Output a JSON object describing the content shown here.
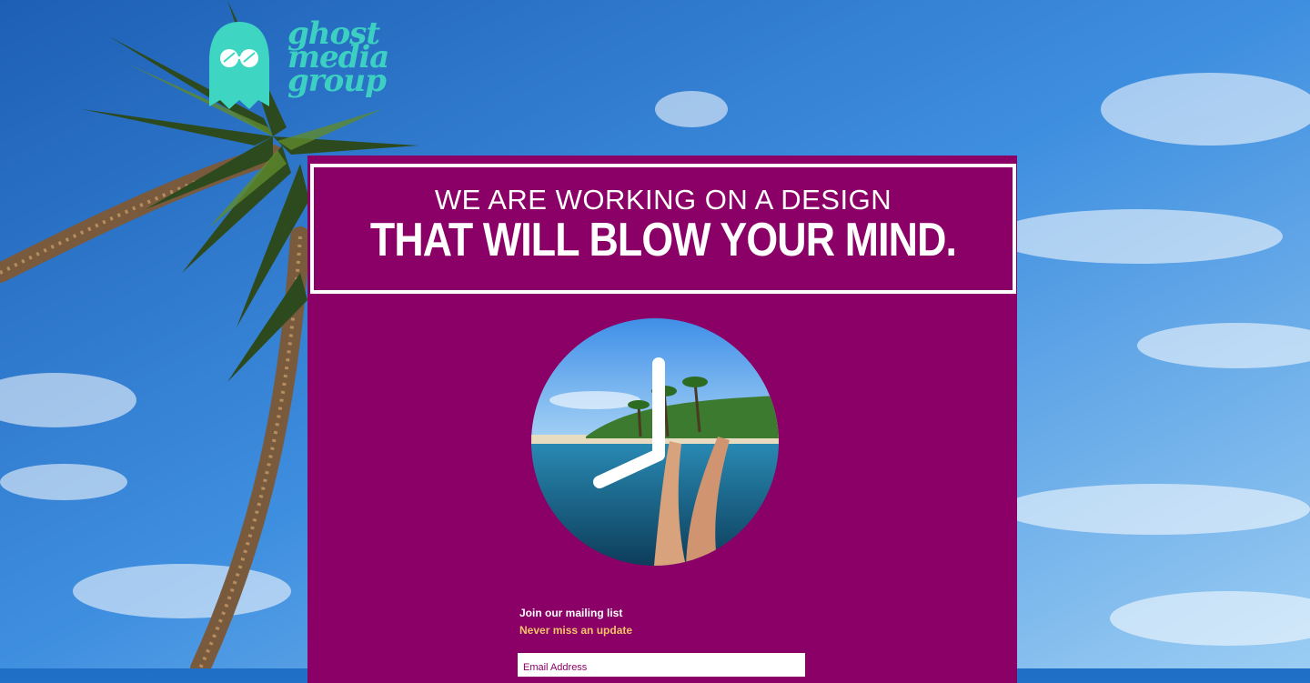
{
  "brand": {
    "logo_lines": [
      "ghost",
      "media",
      "group"
    ],
    "logo_color": "#3ed6c2"
  },
  "headline": {
    "line1": "WE ARE WORKING ON A DESIGN",
    "line2": "THAT WILL BLOW YOUR MIND."
  },
  "colors": {
    "panel": "#8a0066",
    "accent": "#f4c46a",
    "sky": "#3d8ee0"
  },
  "clock_image": "clock-beach-photo",
  "mailing": {
    "title": "Join our mailing list",
    "subtitle": "Never miss an update"
  },
  "form": {
    "email_placeholder": "Email Address"
  }
}
